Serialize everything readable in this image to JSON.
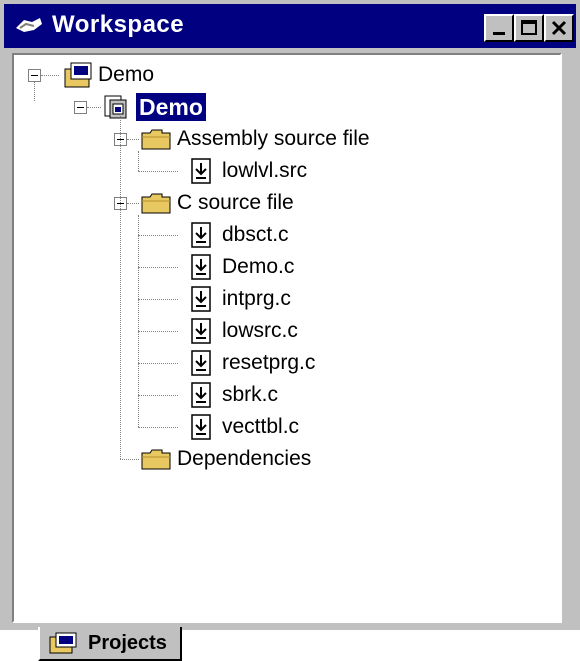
{
  "window": {
    "title": "Workspace"
  },
  "tree": {
    "root": {
      "label": "Demo"
    },
    "project": {
      "label": "Demo"
    },
    "folders": [
      {
        "label": "Assembly source file",
        "files": [
          "lowlvl.src"
        ]
      },
      {
        "label": "C source file",
        "files": [
          "dbsct.c",
          "Demo.c",
          "intprg.c",
          "lowsrc.c",
          "resetprg.c",
          "sbrk.c",
          "vecttbl.c"
        ]
      },
      {
        "label": "Dependencies",
        "files": []
      }
    ]
  },
  "tabs": [
    {
      "label": "Projects"
    }
  ],
  "colors": {
    "title_bar": "#000080",
    "selection": "#000080",
    "face": "#c0c0c0",
    "folder": "#e8c860"
  }
}
